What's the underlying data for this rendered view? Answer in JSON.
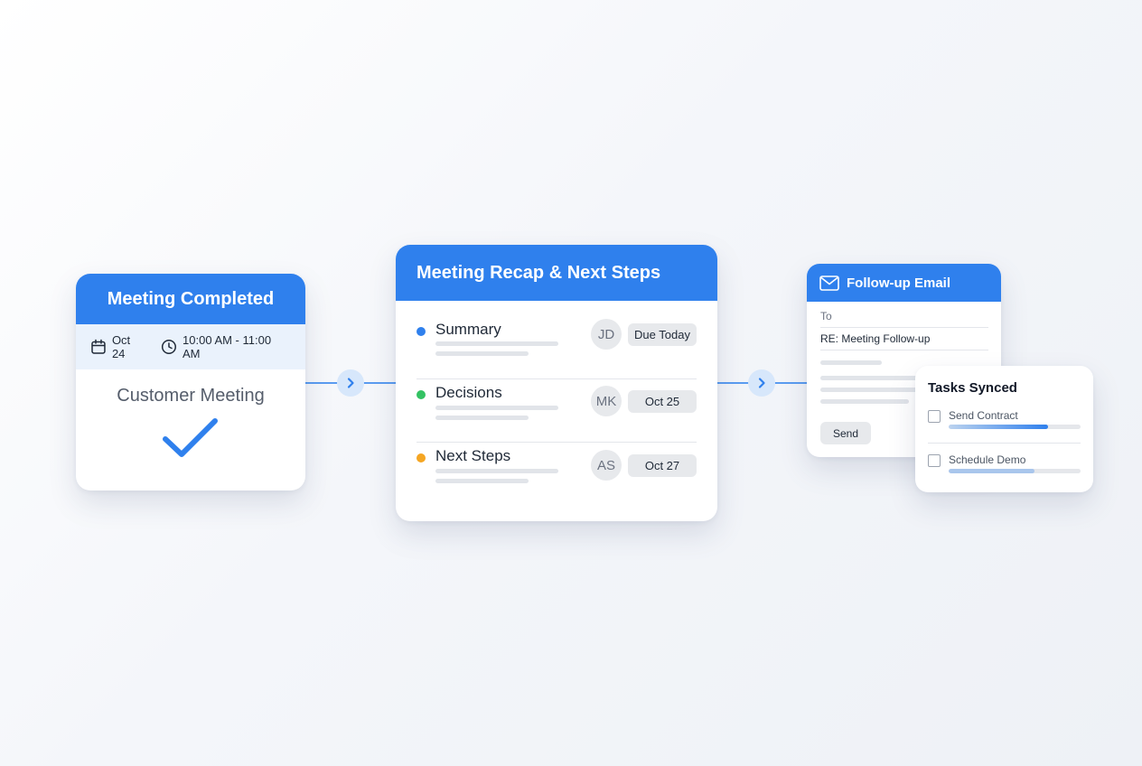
{
  "colors": {
    "primary": "#2f80ed",
    "dot_summary": "#2f80ed",
    "dot_decisions": "#34c263",
    "dot_next_steps": "#f5a623"
  },
  "meeting_card": {
    "header": "Meeting Completed",
    "date": "Oct 24",
    "time": "10:00 AM - 11:00 AM",
    "title": "Customer Meeting",
    "icons": [
      "calendar-icon",
      "clock-icon",
      "checkmark-icon"
    ]
  },
  "recap_card": {
    "header": "Meeting Recap & Next Steps",
    "rows": [
      {
        "label": "Summary",
        "avatar": "JD",
        "due": "Due Today"
      },
      {
        "label": "Decisions",
        "avatar": "MK",
        "due": "Oct 25"
      },
      {
        "label": "Next Steps",
        "avatar": "AS",
        "due": "Oct 27"
      }
    ]
  },
  "email_card": {
    "header": "Follow-up Email",
    "to_label": "To",
    "subject": "RE: Meeting Follow-up",
    "send_label": "Send",
    "icons": [
      "mail-icon"
    ]
  },
  "tasks_card": {
    "title": "Tasks Synced",
    "tasks": [
      {
        "label": "Send Contract",
        "progress": 0.75
      },
      {
        "label": "Schedule Demo",
        "progress": 0.65
      }
    ]
  },
  "connectors": {
    "icons": [
      "chevron-right-icon",
      "chevron-right-icon"
    ]
  }
}
